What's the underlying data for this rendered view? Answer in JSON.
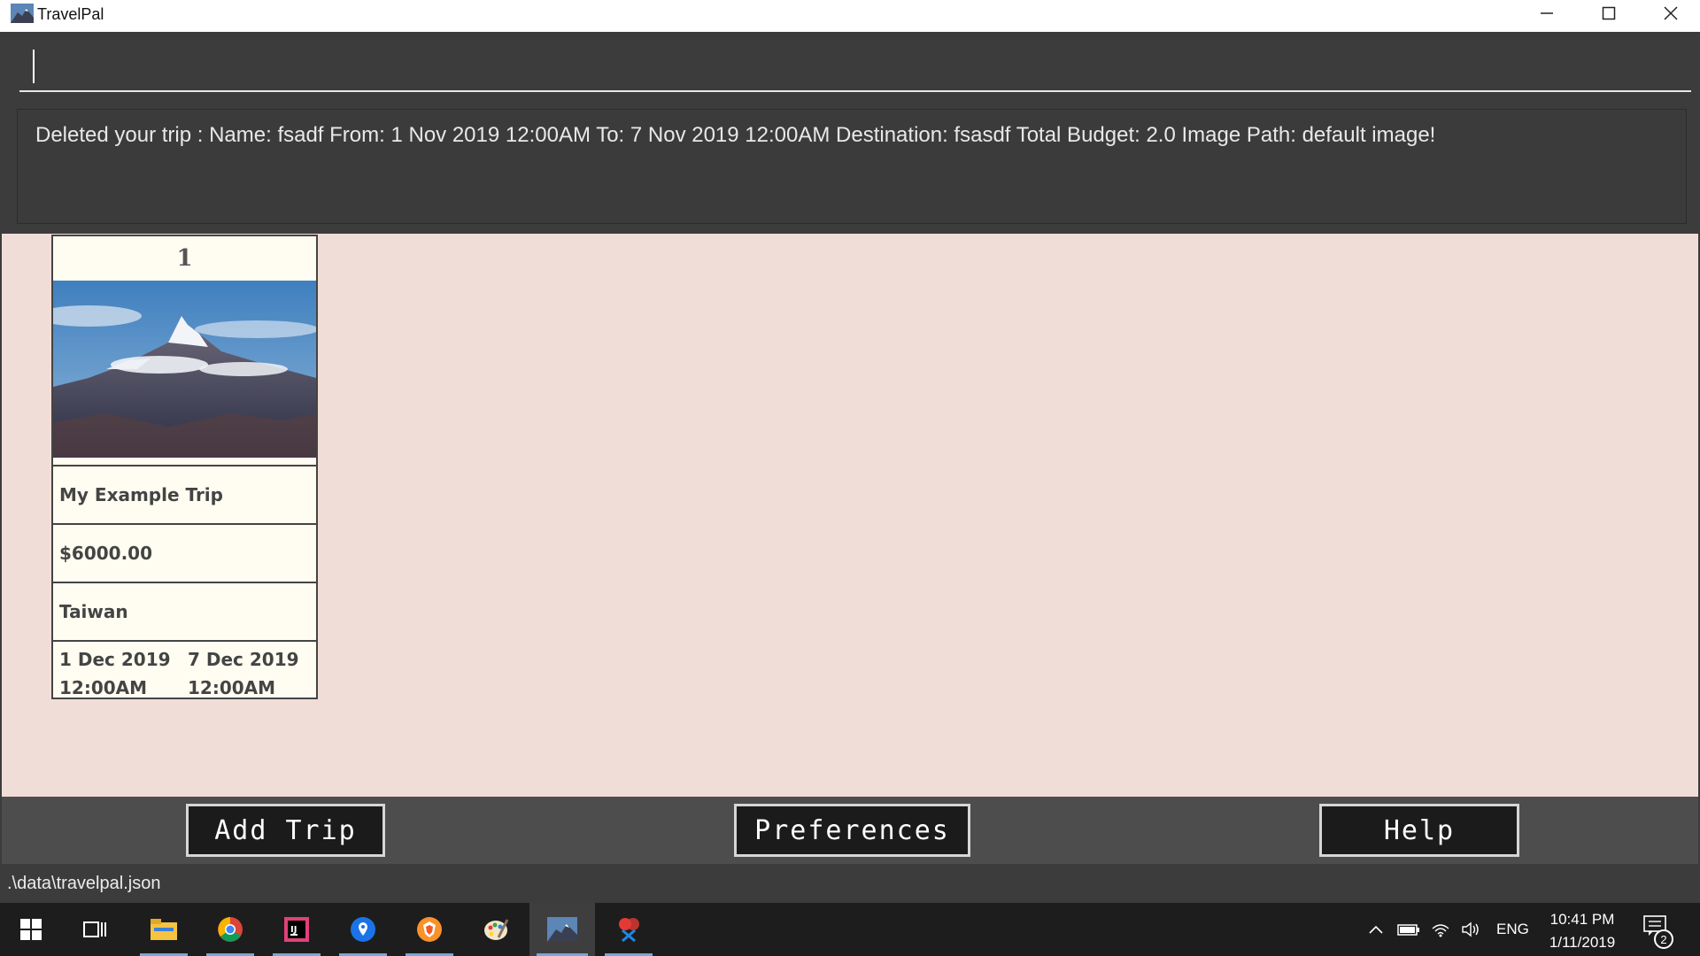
{
  "window": {
    "title": "TravelPal",
    "controls": {
      "minimize": "minimize-icon",
      "maximize": "maximize-icon",
      "close": "close-icon"
    }
  },
  "command": {
    "value": "",
    "placeholder": ""
  },
  "result": {
    "message": "Deleted your trip : Name: fsadf From: 1 Nov 2019 12:00AM To: 7 Nov 2019 12:00AM Destination: fsasdf Total Budget: 2.0 Image Path: default image!"
  },
  "trips": [
    {
      "index": "1",
      "image": "mountain-photo",
      "name": "My Example Trip",
      "budget": "$6000.00",
      "destination": "Taiwan",
      "from": "1 Dec 2019",
      "from_time": "12:00AM",
      "to": "7 Dec 2019",
      "to_time": "12:00AM"
    }
  ],
  "toolbar": {
    "add_trip": "Add Trip",
    "preferences": "Preferences",
    "help": "Help"
  },
  "status": {
    "path": ".\\data\\travelpal.json"
  },
  "taskbar": {
    "apps": [
      "windows-start-icon",
      "task-view-icon",
      "file-explorer-icon",
      "chrome-icon",
      "intellij-icon",
      "maps-icon",
      "brave-icon",
      "paint-icon",
      "travelpal-icon",
      "snipping-icon"
    ],
    "language": "ENG",
    "time": "10:41 PM",
    "date": "1/11/2019",
    "notifications": "2"
  },
  "colors": {
    "panel": "#3c3c3c",
    "trip_background": "#f1ddd7",
    "card_background": "#fffdf1",
    "toolbar": "#4d4d4d",
    "taskbar": "#1d1d1d"
  }
}
